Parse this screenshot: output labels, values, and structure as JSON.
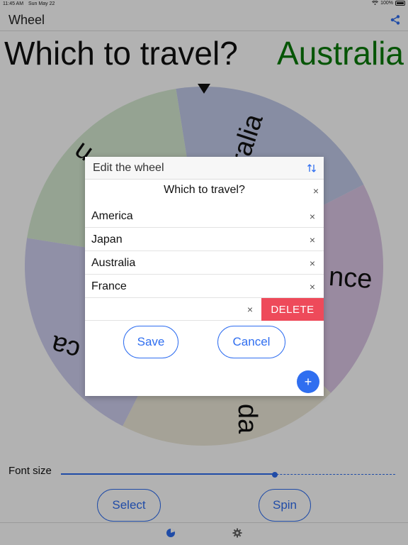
{
  "status": {
    "time": "11:45 AM",
    "date": "Sun May 22",
    "battery": "100%"
  },
  "nav": {
    "title": "Wheel"
  },
  "wheel": {
    "question": "Which to travel?",
    "result": "Australia",
    "result_color": "#0a7a0a",
    "segments": [
      {
        "label": "Australia",
        "color": "#c2cbea"
      },
      {
        "label": "France",
        "color": "#dcc6e6"
      },
      {
        "label": "Canada",
        "color": "#ece8d8"
      },
      {
        "label": "America",
        "color": "#cfcff0"
      },
      {
        "label": "Japan",
        "color": "#d6ead2"
      }
    ],
    "visible_fragments": {
      "top_right": "ralia",
      "top_left": "u",
      "right": "nce",
      "left": "ca",
      "bottom": "da"
    }
  },
  "controls": {
    "font_size_label": "Font size",
    "font_size_value": 0.64,
    "select_label": "Select",
    "spin_label": "Spin"
  },
  "tabs": [
    {
      "name": "wheel-tab",
      "icon": "pie-chart-icon",
      "active": true
    },
    {
      "name": "settings-tab",
      "icon": "gear-icon",
      "active": false
    }
  ],
  "dialog": {
    "title": "Edit the wheel",
    "question": "Which to travel?",
    "items": [
      "America",
      "Japan",
      "Australia",
      "France"
    ],
    "new_item_value": "",
    "delete_label": "DELETE",
    "save_label": "Save",
    "cancel_label": "Cancel",
    "add_label": "+",
    "clear_label": "×"
  },
  "colors": {
    "accent": "#2f6ef0",
    "delete": "#ee4a5a",
    "result": "#0a7a0a"
  }
}
